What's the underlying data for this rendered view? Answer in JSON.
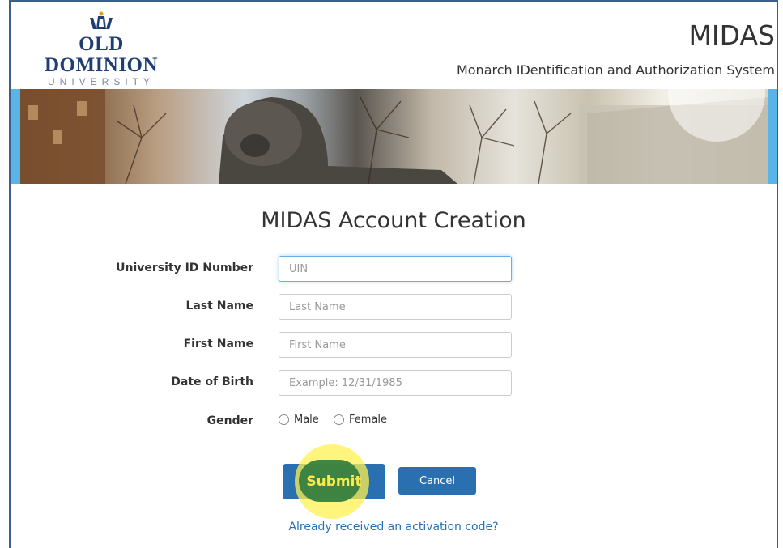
{
  "header": {
    "logo_main": "OLD DOMINION",
    "logo_sub": "UNIVERSITY",
    "site_title": "MIDAS",
    "site_subtitle": "Monarch IDentification and Authorization System"
  },
  "form": {
    "title": "MIDAS Account Creation",
    "fields": [
      {
        "label": "University ID Number",
        "placeholder": "UIN",
        "value": ""
      },
      {
        "label": "Last Name",
        "placeholder": "Last Name",
        "value": ""
      },
      {
        "label": "First Name",
        "placeholder": "First Name",
        "value": ""
      },
      {
        "label": "Date of Birth",
        "placeholder": "Example: 12/31/1985",
        "value": ""
      }
    ],
    "gender": {
      "label": "Gender",
      "options": [
        "Male",
        "Female"
      ]
    },
    "submit_label": "Submit",
    "cancel_label": "Cancel",
    "activation_link": "Already received an activation code?"
  },
  "colors": {
    "brand_navy": "#1f3f73",
    "button_blue": "#2a6fb0",
    "banner_blue": "#5ab4e6",
    "highlight_yellow": "#fff050"
  }
}
